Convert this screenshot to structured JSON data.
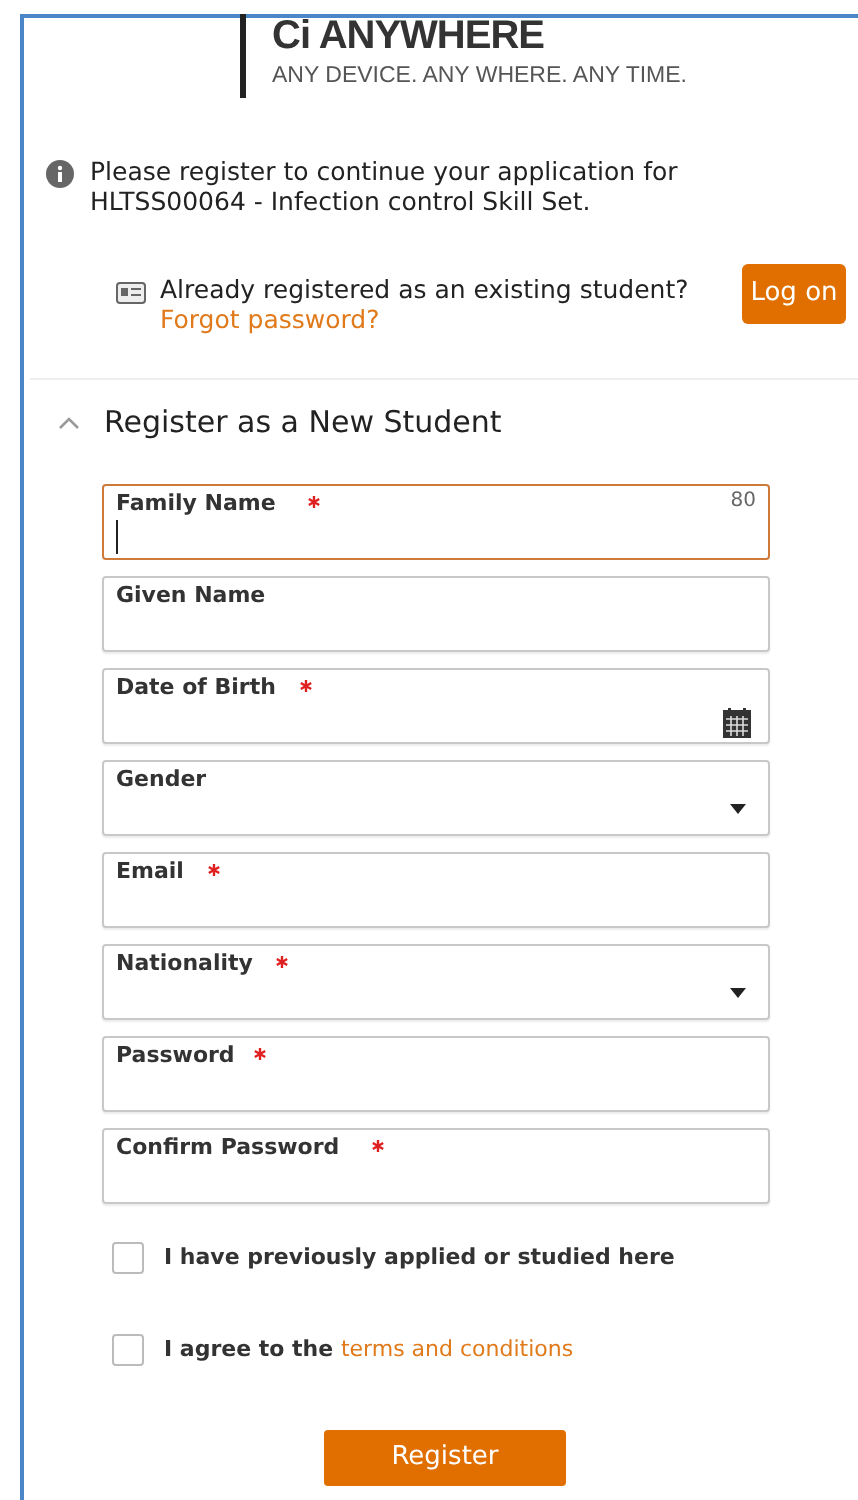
{
  "logo": {
    "title": "Ci ANYWHERE",
    "tagline": "ANY DEVICE. ANY WHERE. ANY TIME."
  },
  "notice": "Please register to continue your application for HLTSS00064 - Infection control Skill Set.",
  "existing": {
    "text": "Already registered as an existing student?",
    "link": "Forgot password?",
    "button": "Log on"
  },
  "section": {
    "title": "Register as a New Student",
    "expanded": true
  },
  "fields": [
    {
      "kind": "text",
      "label": "Family Name",
      "required": true,
      "focused": true,
      "counter": "80"
    },
    {
      "kind": "text",
      "label": "Given Name",
      "required": false,
      "focused": false
    },
    {
      "kind": "date",
      "label": "Date of Birth",
      "required": true,
      "focused": false
    },
    {
      "kind": "select",
      "label": "Gender",
      "required": false,
      "focused": false
    },
    {
      "kind": "text",
      "label": "Email",
      "required": true,
      "focused": false
    },
    {
      "kind": "select",
      "label": "Nationality",
      "required": true,
      "focused": false
    },
    {
      "kind": "password",
      "label": "Password",
      "required": true,
      "focused": false
    },
    {
      "kind": "password",
      "label": "Confirm Password",
      "required": true,
      "focused": false
    }
  ],
  "checkboxes": [
    {
      "label": "I have previously applied or studied here",
      "checked": false
    },
    {
      "label": "I agree to the",
      "link": "terms and conditions",
      "checked": false
    }
  ],
  "submit": "Register"
}
